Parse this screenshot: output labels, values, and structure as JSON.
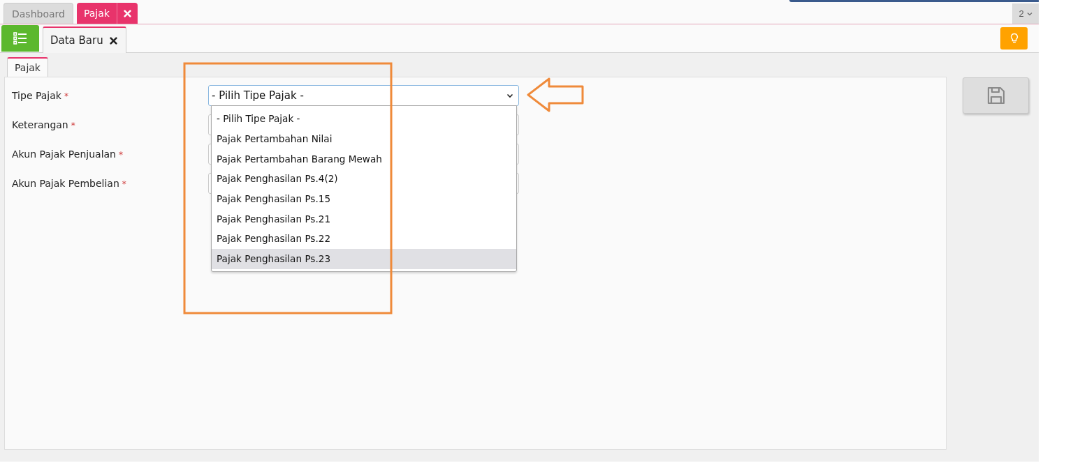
{
  "top_tabs": [
    {
      "label": "Dashboard",
      "selected": false,
      "closable": false
    },
    {
      "label": "Pajak",
      "selected": true,
      "closable": true
    }
  ],
  "page_selector": {
    "label": "2"
  },
  "sub_tabs": [
    {
      "label": "Data Baru",
      "selected": true
    }
  ],
  "form_tabs": [
    {
      "label": "Pajak",
      "selected": true
    }
  ],
  "fields": [
    {
      "label": "Tipe Pajak",
      "marker": "*",
      "kind": "select",
      "value": "- Pilih Tipe Pajak -"
    },
    {
      "label": "Keterangan",
      "marker": "*",
      "kind": "text"
    },
    {
      "label": "Akun Pajak Penjualan",
      "marker": "*",
      "kind": "text"
    },
    {
      "label": "Akun Pajak Pembelian",
      "marker": "*",
      "kind": "text"
    }
  ],
  "dropdown": {
    "options": [
      {
        "label": "- Pilih Tipe Pajak -",
        "selected": false
      },
      {
        "label": "Pajak Pertambahan Nilai",
        "selected": false
      },
      {
        "label": "Pajak Pertambahan Barang Mewah",
        "selected": false
      },
      {
        "label": "Pajak Penghasilan Ps.4(2)",
        "selected": false
      },
      {
        "label": "Pajak Penghasilan Ps.15",
        "selected": false
      },
      {
        "label": "Pajak Penghasilan Ps.21",
        "selected": false
      },
      {
        "label": "Pajak Penghasilan Ps.22",
        "selected": false
      },
      {
        "label": "Pajak Penghasilan Ps.23",
        "selected": true
      }
    ]
  }
}
